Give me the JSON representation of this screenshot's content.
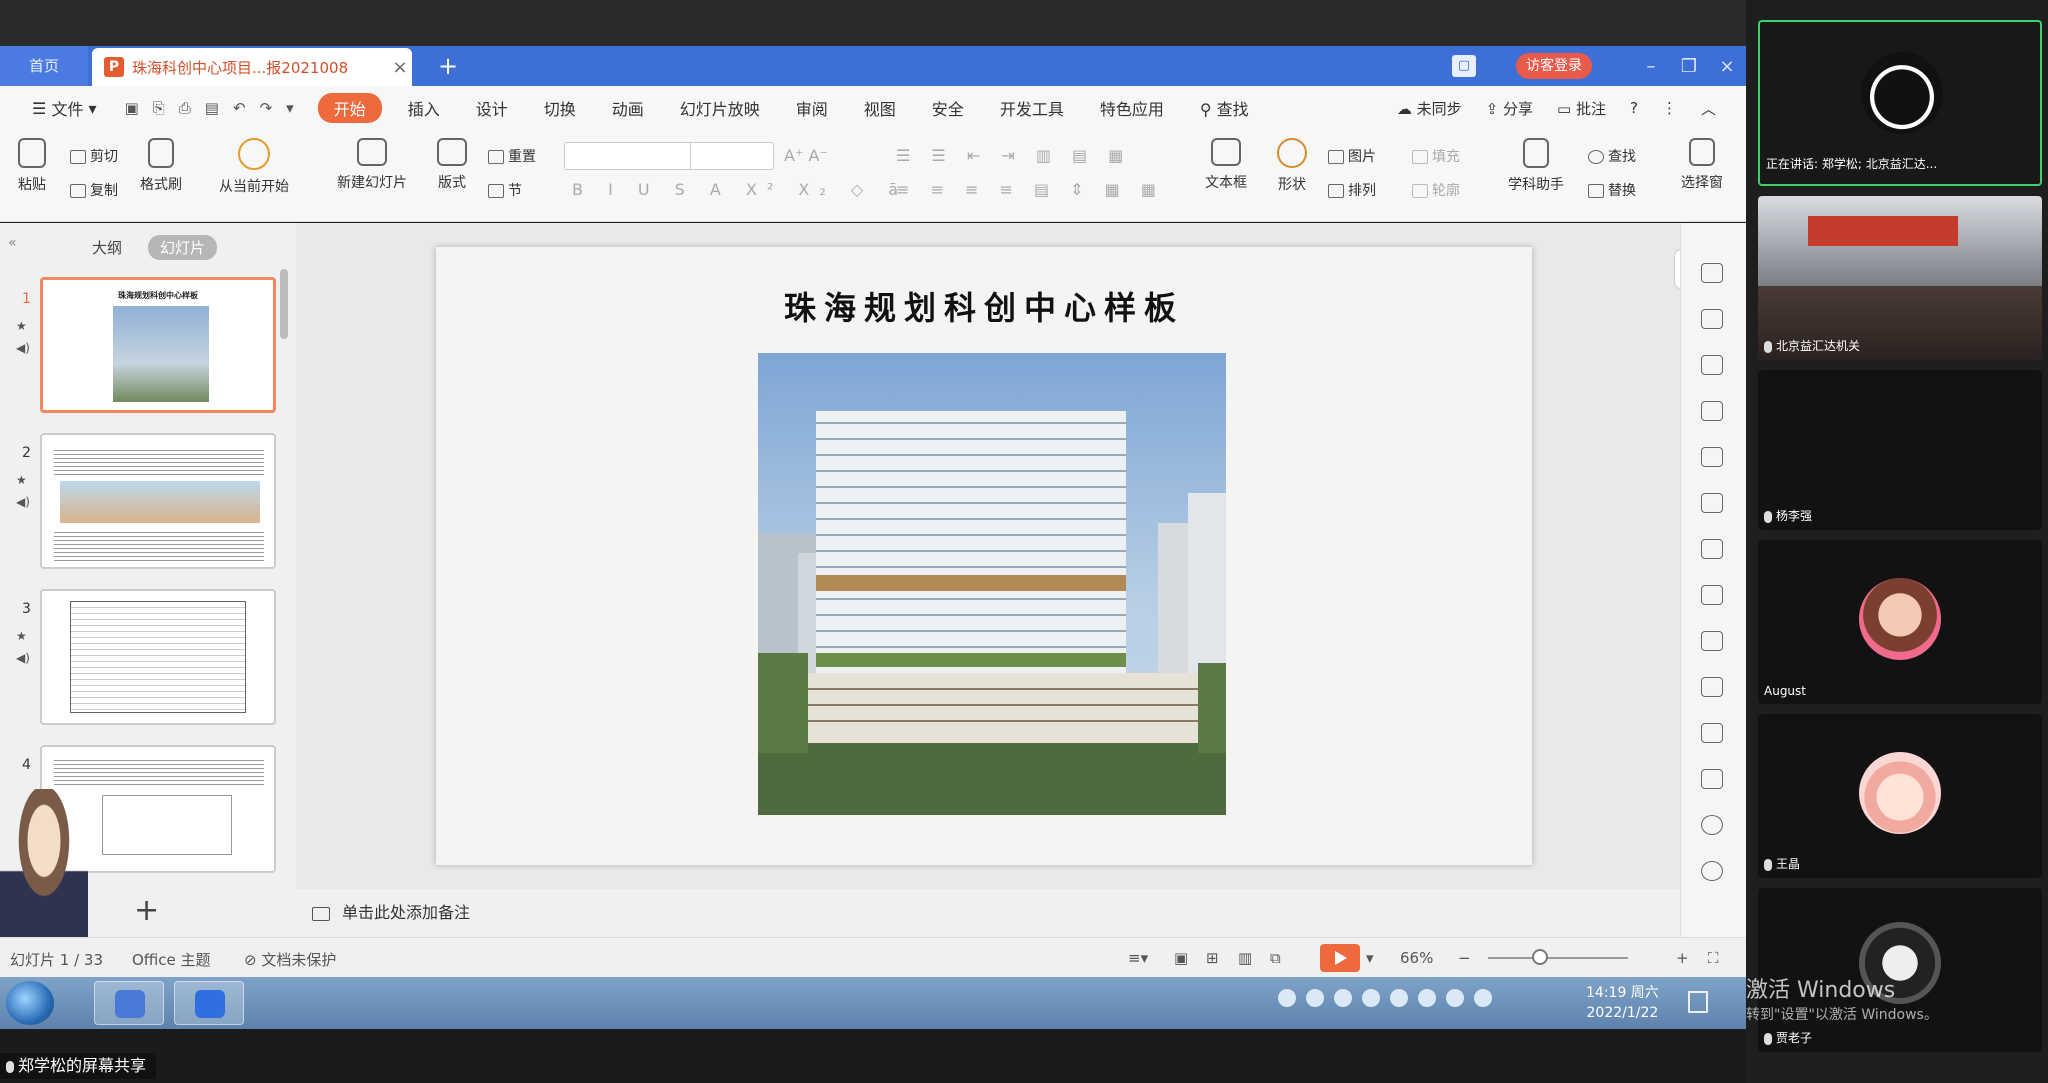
{
  "tabbar": {
    "home_tab": "首页",
    "doc_tab": "珠海科创中心项目...报2021008",
    "visitor_login": "访客登录"
  },
  "menubar": {
    "file": "文件",
    "items": [
      "开始",
      "插入",
      "设计",
      "切换",
      "动画",
      "幻灯片放映",
      "审阅",
      "视图",
      "安全",
      "开发工具",
      "特色应用"
    ],
    "active": "开始",
    "search": "查找",
    "unsync": "未同步",
    "share": "分享",
    "comment": "批注"
  },
  "ribbon": {
    "paste": "粘贴",
    "cut": "剪切",
    "copy": "复制",
    "format_painter": "格式刷",
    "from_current": "从当前开始",
    "new_slide": "新建幻灯片",
    "layout": "版式",
    "reset": "重置",
    "section": "节",
    "textbox": "文本框",
    "shape": "形状",
    "picture": "图片",
    "arrange": "排列",
    "fill": "填充",
    "outline": "轮廓",
    "subject_assistant": "学科助手",
    "find": "查找",
    "replace": "替换",
    "select_pane": "选择窗"
  },
  "leftpanel": {
    "tab_outline": "大纲",
    "tab_slides": "幻灯片",
    "slide_numbers": [
      "1",
      "2",
      "3",
      "4"
    ],
    "thumb1_title": "珠海规划科创中心样板"
  },
  "slide": {
    "title": "珠海规划科创中心样板"
  },
  "notes": {
    "placeholder": "单击此处添加备注"
  },
  "statusbar": {
    "slide_count": "幻灯片 1 / 33",
    "theme": "Office 主题",
    "protection": "文档未保护",
    "zoom": "66%",
    "zoom_value": 0.66
  },
  "taskbar": {
    "time": "14:19 周六",
    "date": "2022/1/22"
  },
  "watermark": {
    "activate": "激活 Windows",
    "activate_hint": "转到\"设置\"以激活 Windows。"
  },
  "share_label": "郑学松的屏幕共享",
  "participants": {
    "speaking": "正在讲话: 郑学松; 北京益汇达...",
    "p2": "北京益汇达机关",
    "p3": "杨李强",
    "p4": "August",
    "p5": "王晶",
    "p6": "贾老子"
  },
  "colors": {
    "accent": "#ee6a3c",
    "tabbar": "#3d6fd6",
    "active_speaker": "#3fd06b"
  }
}
